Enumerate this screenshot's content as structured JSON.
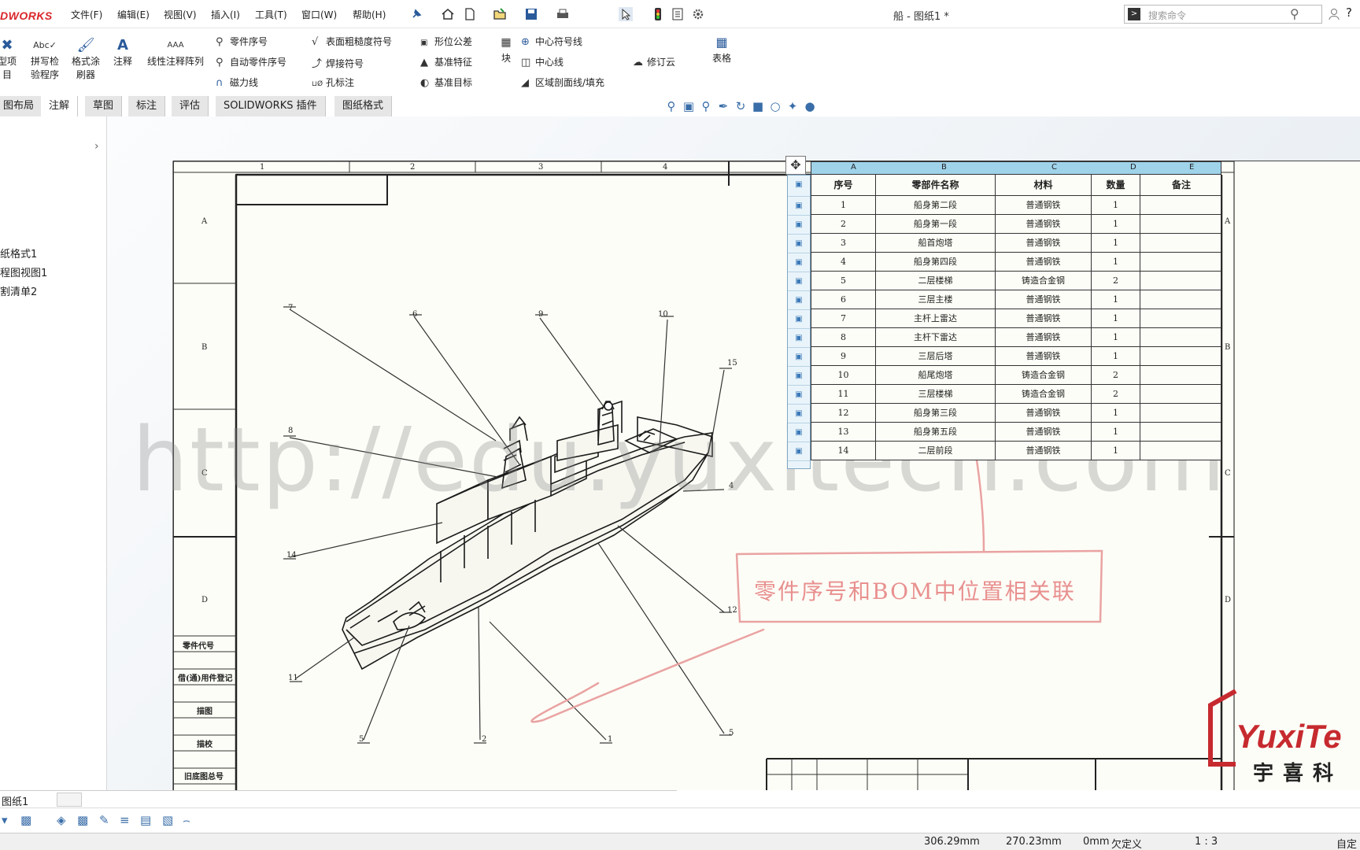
{
  "app": {
    "logo": "DWORKS",
    "title": "船 - 图纸1 *",
    "menus": [
      "文件(F)",
      "编辑(E)",
      "视图(V)",
      "插入(I)",
      "工具(T)",
      "窗口(W)",
      "帮助(H)"
    ],
    "search_placeholder": "搜索命令"
  },
  "ribbon": {
    "big_buttons": [
      {
        "label": "型项\n目",
        "icon": "model-items-icon"
      },
      {
        "label": "拼写检\n验程序",
        "icon": "spell-check-icon"
      },
      {
        "label": "格式涂\n刷器",
        "icon": "format-painter-icon"
      },
      {
        "label": "注释",
        "icon": "note-icon"
      },
      {
        "label": "线性注释阵列",
        "icon": "linear-note-pattern-icon"
      },
      {
        "label": "块",
        "icon": "block-icon"
      },
      {
        "label": "表格",
        "icon": "table-icon"
      }
    ],
    "small_buttons": [
      {
        "label": "零件序号",
        "icon": "balloon-icon"
      },
      {
        "label": "自动零件序号",
        "icon": "auto-balloon-icon"
      },
      {
        "label": "磁力线",
        "icon": "magnetic-line-icon"
      },
      {
        "label": "表面粗糙度符号",
        "icon": "surface-finish-icon"
      },
      {
        "label": "焊接符号",
        "icon": "weld-symbol-icon"
      },
      {
        "label": "孔标注",
        "icon": "hole-callout-icon"
      },
      {
        "label": "形位公差",
        "icon": "geometric-tolerance-icon"
      },
      {
        "label": "基准特征",
        "icon": "datum-feature-icon"
      },
      {
        "label": "基准目标",
        "icon": "datum-target-icon"
      },
      {
        "label": "中心符号线",
        "icon": "center-mark-icon"
      },
      {
        "label": "中心线",
        "icon": "centerline-icon"
      },
      {
        "label": "区域剖面线/填充",
        "icon": "area-hatch-icon"
      },
      {
        "label": "修订云",
        "icon": "revision-cloud-icon"
      }
    ]
  },
  "tabs": [
    "图布局",
    "注解",
    "草图",
    "标注",
    "评估",
    "SOLIDWORKS 插件",
    "图纸格式"
  ],
  "active_tab": "注解",
  "tree": [
    "纸格式1",
    "程图视图1",
    "割清单2"
  ],
  "sheet": {
    "col_zones": [
      "1",
      "2",
      "3",
      "4"
    ],
    "row_zones": [
      "A",
      "B",
      "C",
      "D"
    ],
    "title_block_rows": [
      "零件代号",
      "借(通)用件登记",
      "描图",
      "描校",
      "旧底图总号"
    ],
    "balloons": [
      "7",
      "6",
      "9",
      "10",
      "15",
      "8",
      "4",
      "14",
      "12",
      "11",
      "5",
      "2",
      "1",
      "5"
    ]
  },
  "bom": {
    "column_letters": [
      "A",
      "B",
      "C",
      "D",
      "E"
    ],
    "headers": [
      "序号",
      "零部件名称",
      "材料",
      "数量",
      "备注"
    ],
    "rows": [
      [
        "1",
        "船身第二段",
        "普通钢铁",
        "1",
        ""
      ],
      [
        "2",
        "船身第一段",
        "普通钢铁",
        "1",
        ""
      ],
      [
        "3",
        "船首炮塔",
        "普通钢铁",
        "1",
        ""
      ],
      [
        "4",
        "船身第四段",
        "普通钢铁",
        "1",
        ""
      ],
      [
        "5",
        "二层楼梯",
        "铸造合金钢",
        "2",
        ""
      ],
      [
        "6",
        "三层主楼",
        "普通钢铁",
        "1",
        ""
      ],
      [
        "7",
        "主杆上雷达",
        "普通钢铁",
        "1",
        ""
      ],
      [
        "8",
        "主杆下雷达",
        "普通钢铁",
        "1",
        ""
      ],
      [
        "9",
        "三层后塔",
        "普通钢铁",
        "1",
        ""
      ],
      [
        "10",
        "船尾炮塔",
        "铸造合金钢",
        "2",
        ""
      ],
      [
        "11",
        "三层楼梯",
        "铸造合金钢",
        "2",
        ""
      ],
      [
        "12",
        "船身第三段",
        "普通钢铁",
        "1",
        ""
      ],
      [
        "13",
        "船身第五段",
        "普通钢铁",
        "1",
        ""
      ],
      [
        "14",
        "二层前段",
        "普通钢铁",
        "1",
        ""
      ]
    ]
  },
  "watermark": "http://edu.yuxitech.com",
  "annotation": "零件序号和BOM中位置相关联",
  "brand": {
    "latin": "YuxiTe",
    "cn": "宇喜科"
  },
  "sheet_tab": "图纸1",
  "status": {
    "x": "306.29mm",
    "y": "270.23mm",
    "z": "0mm",
    "state": "欠定义",
    "scale": "1 : 3",
    "mode": "自定"
  },
  "colors": {
    "logo_red": "#d9262b",
    "bom_header": "#9fd3ea",
    "annotation_pink": "#e8908f",
    "brand_red": "#c62a2f"
  }
}
